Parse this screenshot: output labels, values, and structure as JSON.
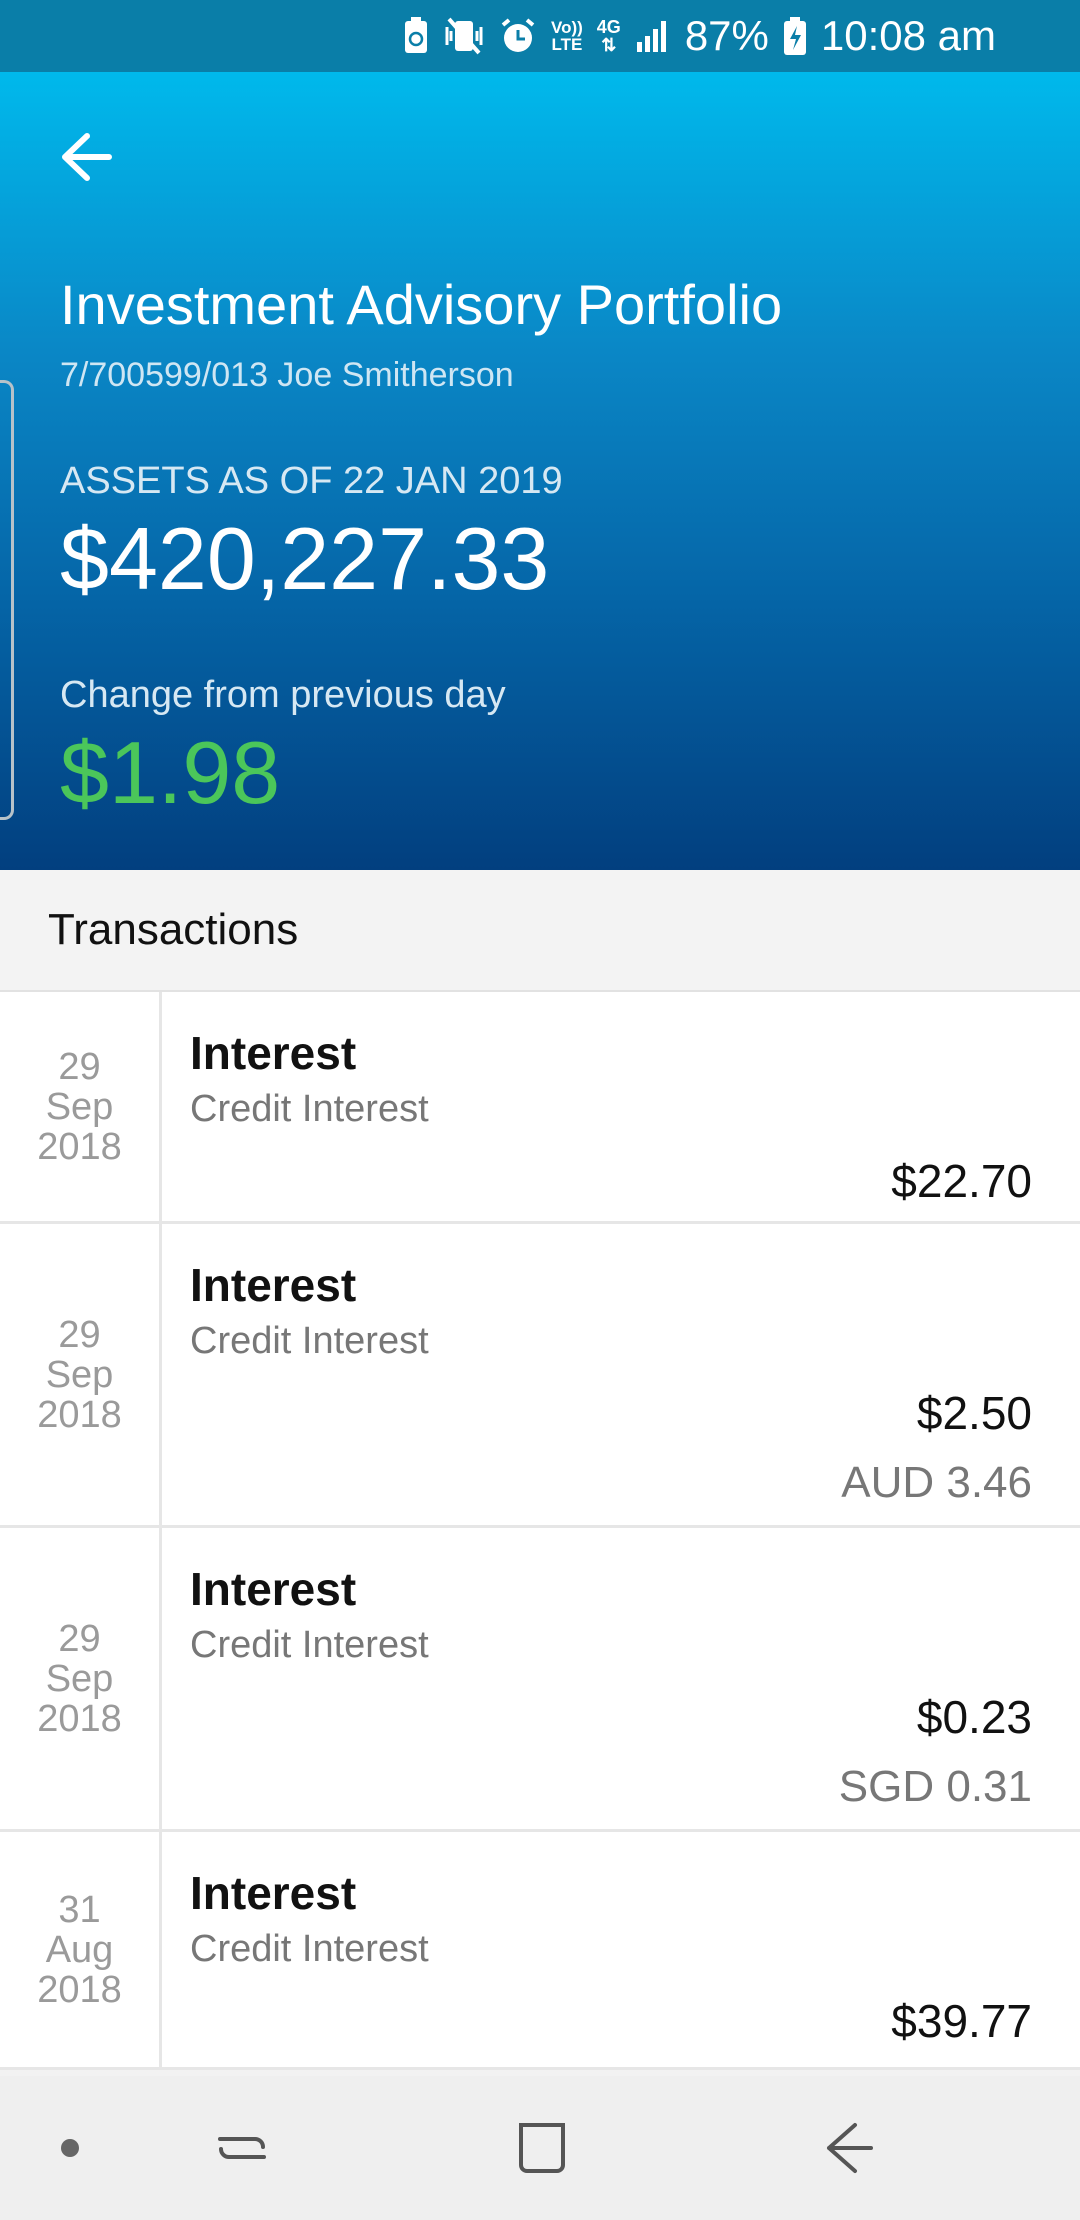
{
  "status_bar": {
    "battery": "87%",
    "time": "10:08 am",
    "network": "4G",
    "volte_top": "Vo))",
    "volte_bottom": "LTE"
  },
  "header": {
    "title": "Investment Advisory Portfolio",
    "account": "7/700599/013 Joe Smitherson",
    "assets_label": "ASSETS AS OF 22 JAN 2019",
    "assets_value": "$420,227.33",
    "change_label": "Change from previous day",
    "change_value": "$1.98",
    "change_color": "#4bc65a"
  },
  "transactions": {
    "heading": "Transactions",
    "items": [
      {
        "day": "29",
        "month": "Sep",
        "year": "2018",
        "title": "Interest",
        "subtitle": "Credit Interest",
        "amount": "$22.70",
        "foreign": ""
      },
      {
        "day": "29",
        "month": "Sep",
        "year": "2018",
        "title": "Interest",
        "subtitle": "Credit Interest",
        "amount": "$2.50",
        "foreign": "AUD 3.46"
      },
      {
        "day": "29",
        "month": "Sep",
        "year": "2018",
        "title": "Interest",
        "subtitle": "Credit Interest",
        "amount": "$0.23",
        "foreign": "SGD 0.31"
      },
      {
        "day": "31",
        "month": "Aug",
        "year": "2018",
        "title": "Interest",
        "subtitle": "Credit Interest",
        "amount": "$39.77",
        "foreign": ""
      }
    ]
  },
  "nav": {
    "icons": [
      "dot-icon",
      "recent-apps-icon",
      "home-icon",
      "back-nav-icon"
    ]
  }
}
